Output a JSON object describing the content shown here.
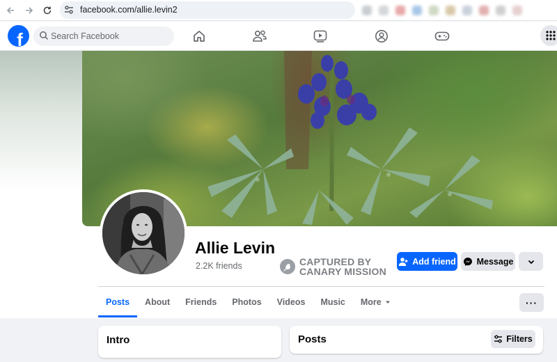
{
  "browser": {
    "url": "facebook.com/allie.levin2"
  },
  "fbnav": {
    "logo_letter": "f",
    "search_placeholder": "Search Facebook",
    "icons": [
      "home-icon",
      "friends-icon",
      "video-icon",
      "groups-icon",
      "gaming-icon",
      "menu-grid-icon"
    ]
  },
  "profile": {
    "name": "Allie Levin",
    "friends": "2.2K friends",
    "stamp_line1": "CAPTURED BY",
    "stamp_line2": "CANARY MISSION",
    "add_friend_label": "Add friend",
    "message_label": "Message"
  },
  "tabs": [
    {
      "label": "Posts",
      "active": true
    },
    {
      "label": "About"
    },
    {
      "label": "Friends"
    },
    {
      "label": "Photos"
    },
    {
      "label": "Videos"
    },
    {
      "label": "Music"
    },
    {
      "label": "More"
    }
  ],
  "more_options_label": "···",
  "intro": {
    "title": "Intro"
  },
  "posts": {
    "title": "Posts",
    "filters_label": "Filters"
  },
  "colors": {
    "brand": "#0866ff",
    "secondary_button": "#e4e6eb",
    "page_bg": "#f0f2f5",
    "muted_text": "#65676b"
  }
}
